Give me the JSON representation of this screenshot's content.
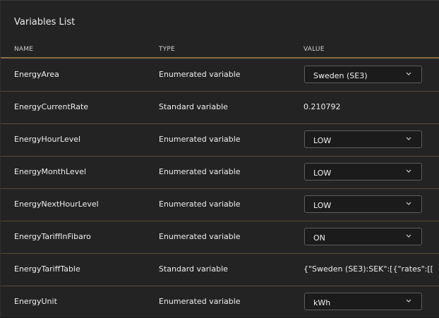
{
  "title": "Variables List",
  "columns": {
    "name": "NAME",
    "type": "TYPE",
    "value": "VALUE"
  },
  "rows": [
    {
      "name": "EnergyArea",
      "type": "Enumerated variable",
      "value": "Sweden (SE3)",
      "control": "select"
    },
    {
      "name": "EnergyCurrentRate",
      "type": "Standard variable",
      "value": "0.210792",
      "control": "text"
    },
    {
      "name": "EnergyHourLevel",
      "type": "Enumerated variable",
      "value": "LOW",
      "control": "select"
    },
    {
      "name": "EnergyMonthLevel",
      "type": "Enumerated variable",
      "value": "LOW",
      "control": "select"
    },
    {
      "name": "EnergyNextHourLevel",
      "type": "Enumerated variable",
      "value": "LOW",
      "control": "select"
    },
    {
      "name": "EnergyTariffInFibaro",
      "type": "Enumerated variable",
      "value": "ON",
      "control": "select"
    },
    {
      "name": "EnergyTariffTable",
      "type": "Standard variable",
      "value": "{\"Sweden (SE3):SEK\":[{\"rates\":[[...",
      "control": "text"
    },
    {
      "name": "EnergyUnit",
      "type": "Enumerated variable",
      "value": "kWh",
      "control": "select"
    }
  ]
}
